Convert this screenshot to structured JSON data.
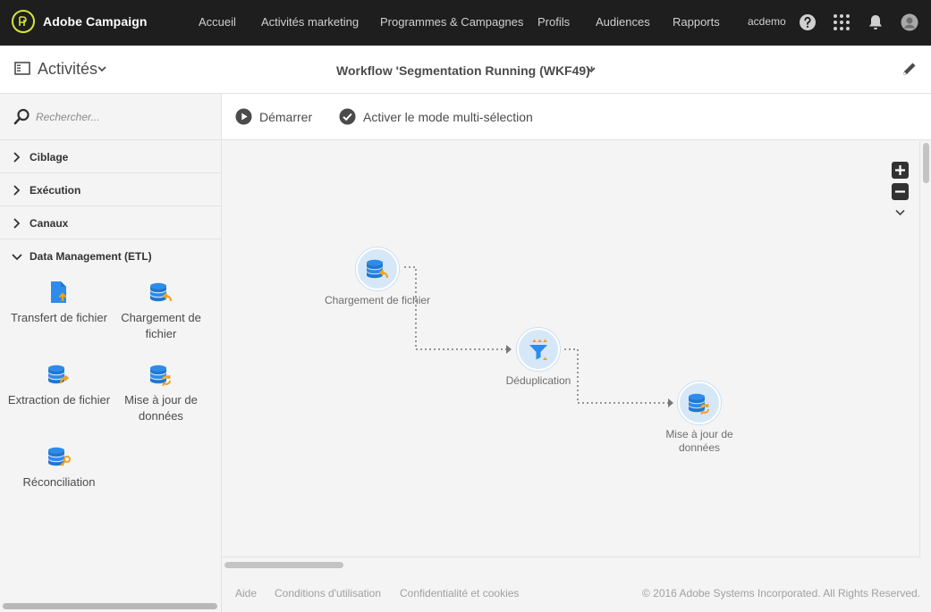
{
  "topbar": {
    "brand": "Adobe Campaign",
    "nav": [
      "Accueil",
      "Activités marketing",
      "Programmes & Campagnes",
      "Profils",
      "Audiences",
      "Rapports"
    ],
    "user": "acdemo"
  },
  "subheader": {
    "title": "Activités",
    "workflow_title": "Workflow 'Segmentation Running (WKF49)'"
  },
  "sidebar": {
    "search_placeholder": "Rechercher...",
    "categories": [
      "Ciblage",
      "Exécution",
      "Canaux",
      "Data Management (ETL)"
    ],
    "tiles": [
      "Transfert de fichier",
      "Chargement de fichier",
      "Extraction de fichier",
      "Mise à jour de données",
      "Réconciliation"
    ]
  },
  "toolbar": {
    "start_label": "Démarrer",
    "multiselect_label": "Activer le mode multi-sélection"
  },
  "canvas": {
    "nodes": [
      {
        "label": "Chargement de fichier",
        "icon": "file-load-icon"
      },
      {
        "label": "Déduplication",
        "icon": "deduplication-icon"
      },
      {
        "label": "Mise à jour de données",
        "icon": "data-update-icon"
      }
    ]
  },
  "footer": {
    "links": [
      "Aide",
      "Conditions d'utilisation",
      "Confidentialité et cookies"
    ],
    "copyright": "© 2016 Adobe Systems Incorporated. All Rights Reserved."
  },
  "colors": {
    "topbar": "#1e1e1e",
    "accent_blue": "#2d8ceb",
    "accent_orange": "#f0a11e",
    "logo_ring": "#d8e33a"
  }
}
